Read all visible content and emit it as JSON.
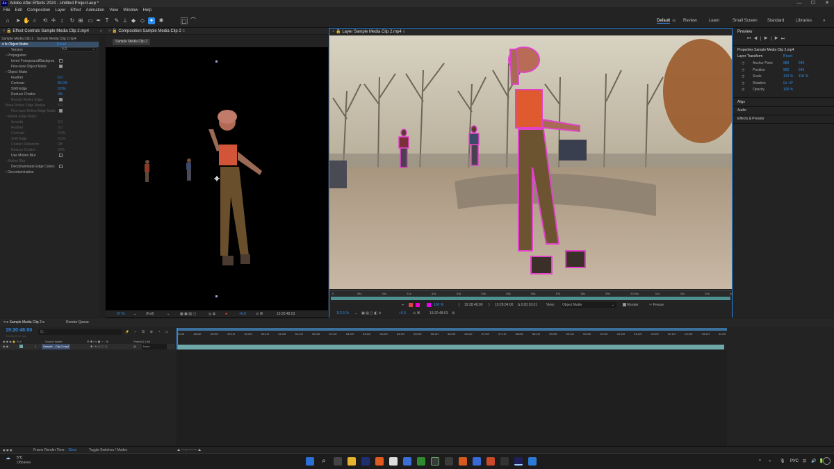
{
  "window": {
    "title": "Adobe After Effects 2024 - Untitled Project.aep *",
    "app_badge": "Ae",
    "minimize": "—",
    "maximize": "☐",
    "close": "✕"
  },
  "menu": [
    "File",
    "Edit",
    "Composition",
    "Layer",
    "Effect",
    "Animation",
    "View",
    "Window",
    "Help"
  ],
  "workspaces": [
    "Default",
    "Review",
    "Learn",
    "Small Screen",
    "Standard",
    "Libraries"
  ],
  "workspace_more": "»",
  "effect_controls": {
    "tab": "Effect Controls Sample Media Clip 2.mp4",
    "layer_line": "Sample Media Clip 2 · Sample Media Clip 2.mp4",
    "fx_name": "Object Matte",
    "reset": "Reset",
    "version_label": "Version",
    "version_value": "4.0",
    "rows": [
      {
        "label": "Propagation",
        "value": ""
      },
      {
        "label": "Invert Foreground/Backgrou",
        "value": ""
      },
      {
        "label": "Fine-tune Object Matte",
        "value": ""
      },
      {
        "label": "Object Matte",
        "value": ""
      },
      {
        "label": "Feather",
        "value": "5.0"
      },
      {
        "label": "Contrast",
        "value": "80.0%"
      },
      {
        "label": "Shift Edge",
        "value": "0.0%"
      },
      {
        "label": "Reduce Chatter",
        "value": "0%"
      },
      {
        "label": "Render Refine Edge",
        "value": ""
      },
      {
        "label": "Base Refine Edge Radius",
        "value": "5.0"
      },
      {
        "label": "Fine-tune Refine Edge Matte",
        "value": ""
      },
      {
        "label": "Refine Edge Matte",
        "value": ""
      },
      {
        "label": "Smooth",
        "value": "0.0"
      },
      {
        "label": "Feather",
        "value": "0.0"
      },
      {
        "label": "Contrast",
        "value": "0.0%"
      },
      {
        "label": "Shift Edge",
        "value": "0.0%"
      },
      {
        "label": "Chatter Reduction",
        "value": "Off"
      },
      {
        "label": "Reduce Chatter",
        "value": "50%"
      },
      {
        "label": "Use Motion Blur",
        "value": ""
      },
      {
        "label": "Motion Blur",
        "value": ""
      },
      {
        "label": "Decontaminate Edge Colors",
        "value": ""
      },
      {
        "label": "Decontamination",
        "value": ""
      }
    ]
  },
  "composition": {
    "tab": "Composition Sample Media Clip 2",
    "chip": "Sample Media Clip 2",
    "zoom": "67 %",
    "resolution": "(Full)",
    "exposure": "+0.0",
    "timecode": "19:20:48:03"
  },
  "layer_viewer": {
    "tab": "Layer Sample Media Clip 2.mp4",
    "ruler_ticks": [
      "0",
      "49s",
      "50s",
      "51s",
      "52s",
      "53s",
      "54s",
      "55s",
      "56s",
      "57s",
      "58s",
      "59s",
      "20:00s",
      "01s",
      "02s",
      "03s",
      "04"
    ],
    "in_time": "19:28:48:00",
    "out_time": "19:29:04:00",
    "duration": "Δ 0:00:16:01",
    "view_label": "View:",
    "view_value": "Object Matte",
    "render_label": "Render",
    "freeze_label": "Freeze",
    "zoom": "112.5 %",
    "zoom_pct": "100 %",
    "exposure": "+0.0",
    "timecode": "19:20:48:03"
  },
  "preview": {
    "tab": "Preview",
    "controls": [
      "⏮",
      "◀|",
      "▶",
      "|▶",
      "⏭"
    ]
  },
  "properties": {
    "tab": "Properties Sample Media Clip 2.mp4",
    "section": "Layer Transform",
    "reset": "Reset",
    "rows": [
      {
        "label": "Anchor Point",
        "v1": "960",
        "v2": "540"
      },
      {
        "label": "Position",
        "v1": "960",
        "v2": "540"
      },
      {
        "label": "Scale",
        "v1": "100 %",
        "v2": "100 %"
      },
      {
        "label": "Rotation",
        "v1": "0x +0°",
        "v2": ""
      },
      {
        "label": "Opacity",
        "v1": "100 %",
        "v2": ""
      }
    ],
    "align": "Align",
    "audio": "Audio",
    "effects_presets": "Effects & Presets"
  },
  "timeline": {
    "tab": "Sample Media Clip 2",
    "render_queue": "Render Queue",
    "current_time": "19:20:48:00",
    "fps_line": "69648(30.00 fps)",
    "search_placeholder": "Q₊",
    "col_source": "Source Name",
    "col_parent": "Parent & Link",
    "layer_num": "1",
    "layer_name": "Sample ...Clip 2.mp4",
    "parent_value": "None",
    "ticks": [
      "48:00f",
      "48:12f",
      "49:00f",
      "49:12f",
      "50:00f",
      "50:12f",
      "51:00f",
      "51:12f",
      "52:00f",
      "52:12f",
      "53:00f",
      "53:12f",
      "54:00f",
      "54:12f",
      "55:00f",
      "55:12f",
      "56:00f",
      "56:12f",
      "57:00f",
      "57:12f",
      "58:00f",
      "58:12f",
      "59:00f",
      "59:12f",
      "00:00f",
      "00:12f",
      "01:00f",
      "01:12f",
      "02:00f",
      "02:12f",
      "03:00f",
      "03:12f",
      "04:00"
    ],
    "frame_render": "Frame Render Time:",
    "frame_render_value": "15ms",
    "toggle": "Toggle Switches / Modes"
  },
  "taskbar": {
    "weather_temp": "5°C",
    "weather_desc": "Облачно",
    "lang": "РУС",
    "tray": [
      "^",
      "⌁",
      "🎙",
      "⊡",
      "🔊",
      "🔋"
    ]
  },
  "colors": {
    "accent": "#2d8ceb",
    "matte_outline": "#e043c8",
    "timeline_bar": "#6fa8a8"
  }
}
